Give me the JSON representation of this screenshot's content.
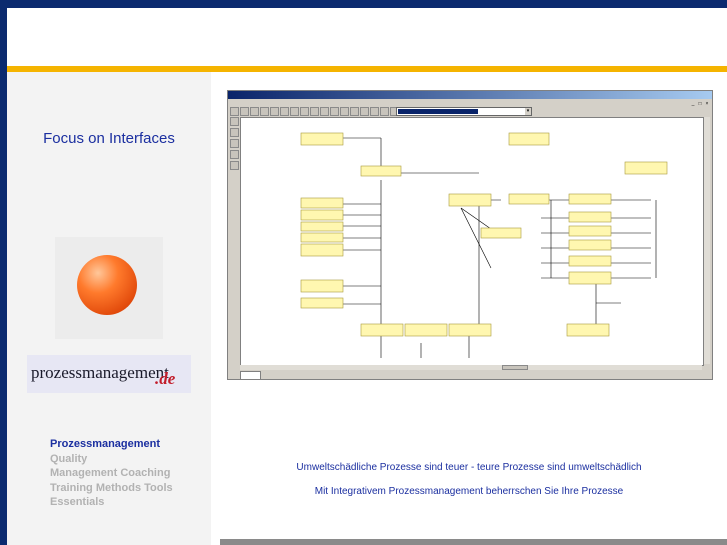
{
  "sidebar": {
    "title": "Focus on Interfaces",
    "logo": {
      "main": "prozessmanagement",
      "accent": ".de"
    },
    "nav_words": [
      "Prozessmanagement",
      "Quality",
      "Management",
      "Coaching",
      "Training",
      "Methods",
      "Tools",
      "Essentials"
    ]
  },
  "main": {
    "caption_line1": "Umweltschädliche Prozesse sind teuer - teure Prozesse sind umweltschädlich",
    "caption_line2": "Mit Integrativem Prozessmanagement beherrschen Sie Ihre Prozesse"
  },
  "colors": {
    "navy": "#0b2a6f",
    "orange": "#f5b400",
    "link_blue": "#1b2fa0",
    "inactive_gray": "#b2b2b2",
    "node_yellow": "#fff7b0"
  },
  "icons": [
    "orange-ball-icon",
    "window-minimize-icon",
    "window-maximize-icon",
    "window-close-icon"
  ]
}
